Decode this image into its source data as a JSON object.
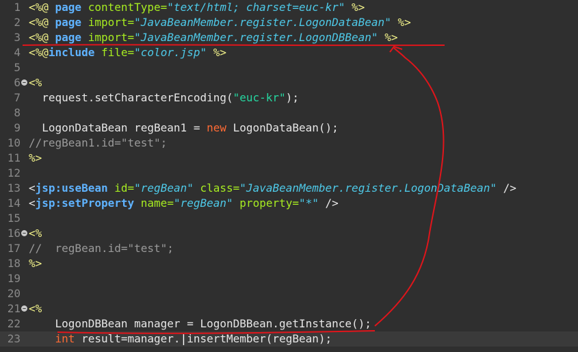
{
  "editor": {
    "lines": [
      {
        "n": "1",
        "segments": [
          {
            "t": "<%@ ",
            "c": "tag"
          },
          {
            "t": "page",
            "c": "kw"
          },
          {
            "t": " ",
            "c": "plain"
          },
          {
            "t": "contentType=",
            "c": "attr"
          },
          {
            "t": "\"text/html; charset=euc-kr\"",
            "c": "str"
          },
          {
            "t": " %>",
            "c": "tag"
          }
        ]
      },
      {
        "n": "2",
        "segments": [
          {
            "t": "<%@ ",
            "c": "tag"
          },
          {
            "t": "page",
            "c": "kw"
          },
          {
            "t": " ",
            "c": "plain"
          },
          {
            "t": "import=",
            "c": "attr"
          },
          {
            "t": "\"JavaBeanMember.register.LogonDataBean\"",
            "c": "str"
          },
          {
            "t": " %>",
            "c": "tag"
          }
        ]
      },
      {
        "n": "3",
        "segments": [
          {
            "t": "<%@ ",
            "c": "tag"
          },
          {
            "t": "page",
            "c": "kw"
          },
          {
            "t": " ",
            "c": "plain"
          },
          {
            "t": "import=",
            "c": "attr"
          },
          {
            "t": "\"JavaBeanMember.register.LogonDBBean\"",
            "c": "str"
          },
          {
            "t": " %>",
            "c": "tag"
          }
        ]
      },
      {
        "n": "4",
        "segments": [
          {
            "t": "<%@",
            "c": "tag"
          },
          {
            "t": "include",
            "c": "kw"
          },
          {
            "t": " ",
            "c": "plain"
          },
          {
            "t": "file=",
            "c": "attr"
          },
          {
            "t": "\"color.jsp\"",
            "c": "str"
          },
          {
            "t": " %>",
            "c": "tag"
          }
        ]
      },
      {
        "n": "5",
        "segments": []
      },
      {
        "n": "6",
        "fold": true,
        "segments": [
          {
            "t": "<%",
            "c": "tag"
          }
        ]
      },
      {
        "n": "7",
        "segments": [
          {
            "t": "  request.setCharacterEncoding(",
            "c": "plain"
          },
          {
            "t": "\"euc-kr\"",
            "c": "jstr"
          },
          {
            "t": ");",
            "c": "plain"
          }
        ]
      },
      {
        "n": "8",
        "segments": []
      },
      {
        "n": "9",
        "segments": [
          {
            "t": "  LogonDataBean regBean1 = ",
            "c": "plain"
          },
          {
            "t": "new",
            "c": "jkw"
          },
          {
            "t": " LogonDataBean();",
            "c": "plain"
          }
        ]
      },
      {
        "n": "10",
        "segments": [
          {
            "t": "//regBean1.id=\"test\";",
            "c": "cm"
          }
        ]
      },
      {
        "n": "11",
        "segments": [
          {
            "t": "%>",
            "c": "tag"
          }
        ]
      },
      {
        "n": "12",
        "segments": []
      },
      {
        "n": "13",
        "segments": [
          {
            "t": "<",
            "c": "plain"
          },
          {
            "t": "jsp:useBean",
            "c": "kw"
          },
          {
            "t": " ",
            "c": "plain"
          },
          {
            "t": "id=",
            "c": "attr"
          },
          {
            "t": "\"regBean\"",
            "c": "str"
          },
          {
            "t": " ",
            "c": "plain"
          },
          {
            "t": "class=",
            "c": "attr"
          },
          {
            "t": "\"JavaBeanMember.register.LogonDataBean\"",
            "c": "str"
          },
          {
            "t": " />",
            "c": "plain"
          }
        ]
      },
      {
        "n": "14",
        "segments": [
          {
            "t": "<",
            "c": "plain"
          },
          {
            "t": "jsp:setProperty",
            "c": "kw"
          },
          {
            "t": " ",
            "c": "plain"
          },
          {
            "t": "name=",
            "c": "attr"
          },
          {
            "t": "\"regBean\"",
            "c": "str"
          },
          {
            "t": " ",
            "c": "plain"
          },
          {
            "t": "property=",
            "c": "attr"
          },
          {
            "t": "\"*\"",
            "c": "str"
          },
          {
            "t": " />",
            "c": "plain"
          }
        ]
      },
      {
        "n": "15",
        "segments": []
      },
      {
        "n": "16",
        "fold": true,
        "segments": [
          {
            "t": "<%",
            "c": "tag"
          }
        ]
      },
      {
        "n": "17",
        "segments": [
          {
            "t": "//  regBean.id=\"test\";",
            "c": "cm"
          }
        ]
      },
      {
        "n": "18",
        "segments": [
          {
            "t": "%>",
            "c": "tag"
          }
        ]
      },
      {
        "n": "19",
        "segments": []
      },
      {
        "n": "20",
        "segments": []
      },
      {
        "n": "21",
        "fold": true,
        "segments": [
          {
            "t": "<%",
            "c": "tag"
          }
        ]
      },
      {
        "n": "22",
        "segments": [
          {
            "t": "    LogonDBBean manager = LogonDBBean.getInstance();",
            "c": "plain"
          }
        ]
      },
      {
        "n": "23",
        "current": true,
        "segments": [
          {
            "t": "    ",
            "c": "plain"
          },
          {
            "t": "int",
            "c": "jkw"
          },
          {
            "t": " result=manager.",
            "c": "plain"
          },
          {
            "t": "|",
            "c": "cursor"
          },
          {
            "t": "insertMember(regBean);",
            "c": "plain"
          }
        ]
      }
    ]
  },
  "colors": {
    "background": "#2f2f2f",
    "current_line": "#3a3a3a",
    "annotation": "#e0151b"
  }
}
